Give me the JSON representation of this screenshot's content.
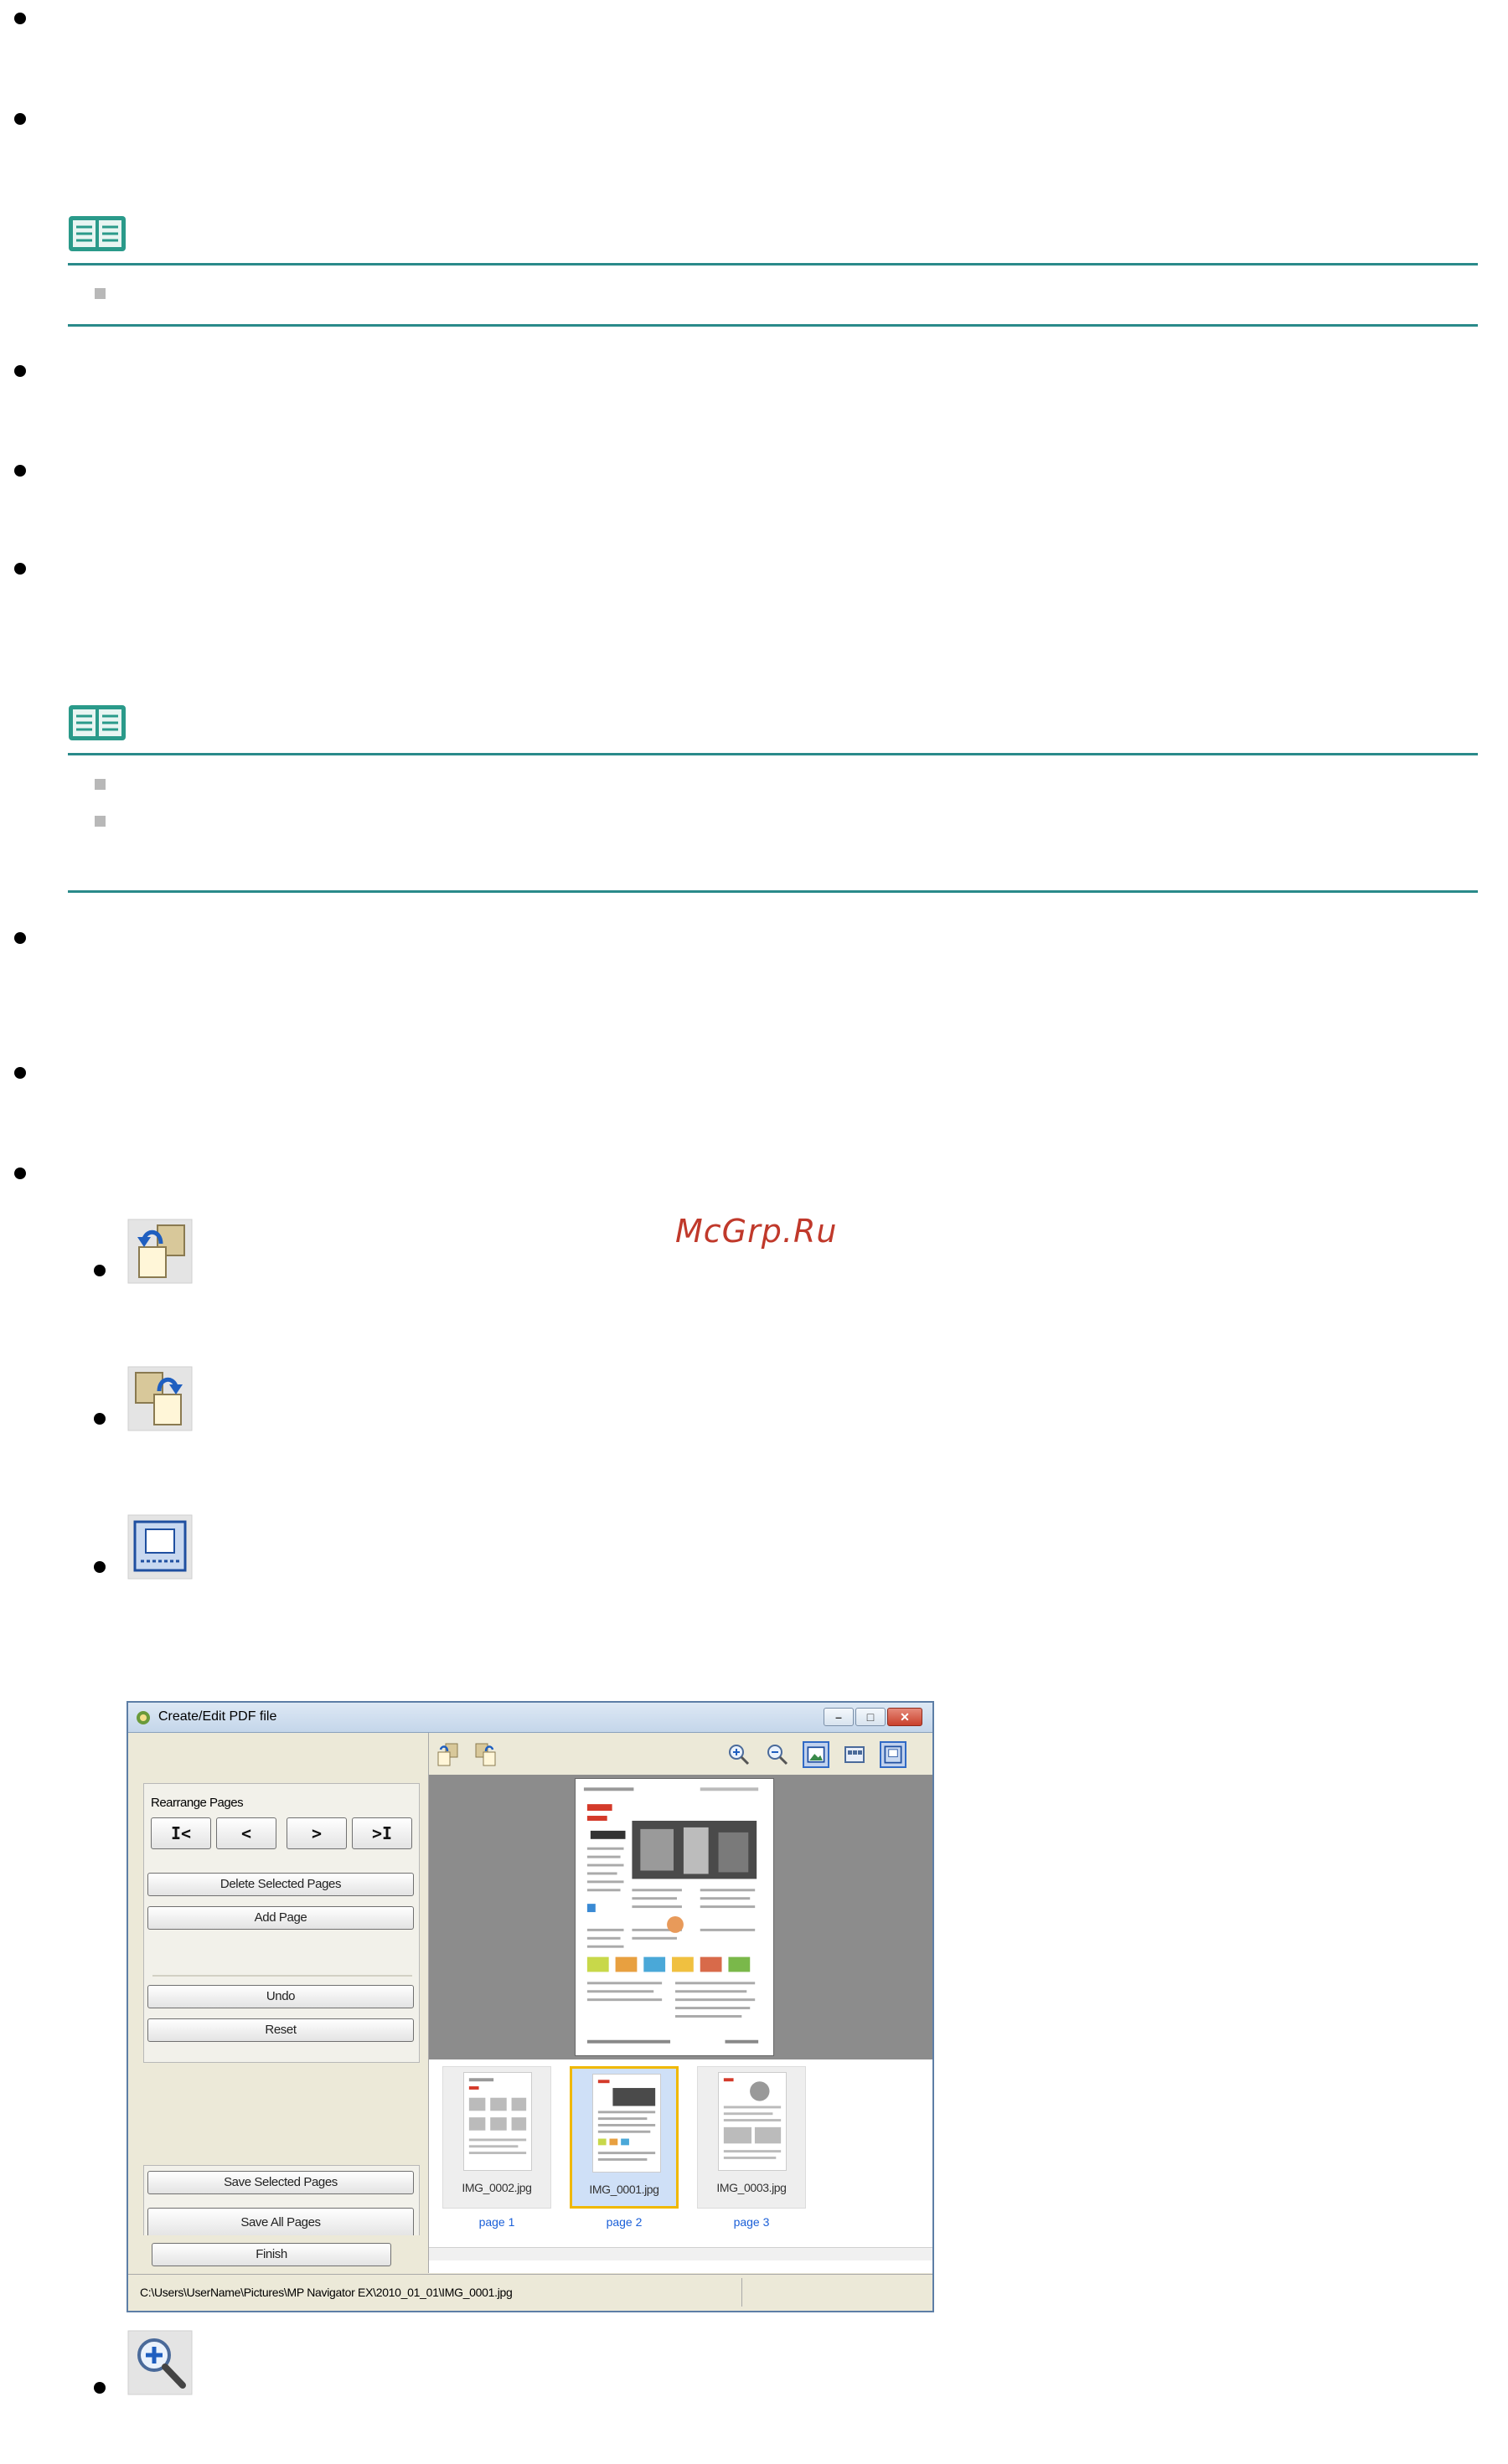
{
  "watermark": "McGrp.Ru",
  "window": {
    "title": "Create/Edit PDF file",
    "minimize_glyph": "–",
    "maximize_glyph": "□",
    "close_glyph": "✕",
    "left_panel": {
      "group_label": "Rearrange Pages",
      "nav_first": "I<",
      "nav_prev": "<",
      "nav_next": ">",
      "nav_last": ">I",
      "delete_label": "Delete Selected Pages",
      "add_label": "Add Page",
      "undo_label": "Undo",
      "reset_label": "Reset",
      "save_selected_label": "Save Selected Pages",
      "save_all_label": "Save All Pages",
      "finish_label": "Finish"
    },
    "thumbnails": [
      {
        "file": "IMG_0002.jpg",
        "page": "page 1",
        "selected": false
      },
      {
        "file": "IMG_0001.jpg",
        "page": "page 2",
        "selected": true
      },
      {
        "file": "IMG_0003.jpg",
        "page": "page 3",
        "selected": false
      }
    ],
    "status_path": "C:\\Users\\UserName\\Pictures\\MP Navigator EX\\2010_01_01\\IMG_0001.jpg"
  },
  "icons": {
    "rotate_left": "rotate-left-icon",
    "rotate_right": "rotate-right-icon",
    "full_screen": "full-screen-icon",
    "zoom_in": "zoom-in-icon",
    "note": "note-book-icon"
  },
  "colors": {
    "rule": "#2a8a8a",
    "watermark": "#c0392b",
    "selection": "#f0b800",
    "page_link": "#1a5fd8"
  }
}
